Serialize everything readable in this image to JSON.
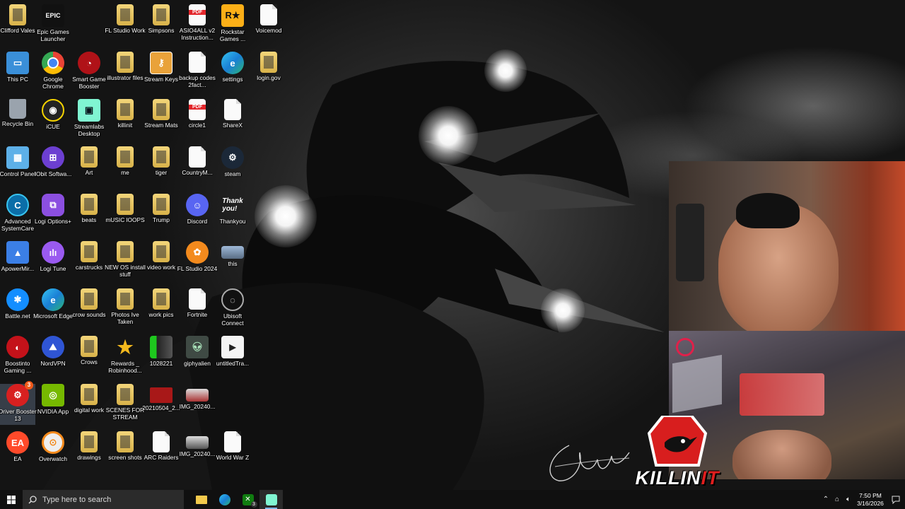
{
  "desktop": {
    "icons": [
      {
        "label": "Clifford Vales",
        "icon": "user-folder-icon"
      },
      {
        "label": "Epic Games Launcher",
        "icon": "epic-games-icon"
      },
      {
        "label": "FL Studio Work",
        "icon": "folder-icon"
      },
      {
        "label": "Simpsons",
        "icon": "folder-icon"
      },
      {
        "label": "ASIO4ALL v2 Instruction...",
        "icon": "pdf-icon"
      },
      {
        "label": "Rockstar Games ...",
        "icon": "rockstar-icon"
      },
      {
        "label": "Voicemod",
        "icon": "document-icon"
      },
      {
        "label": "This PC",
        "icon": "this-pc-icon"
      },
      {
        "label": "Google Chrome",
        "icon": "chrome-icon"
      },
      {
        "label": "Smart Game Booster",
        "icon": "game-booster-icon"
      },
      {
        "label": "illustrator files",
        "icon": "folder-icon"
      },
      {
        "label": "Stream Keys",
        "icon": "key-icon"
      },
      {
        "label": "backup codes 2fact...",
        "icon": "document-icon"
      },
      {
        "label": "settings",
        "icon": "edge-icon"
      },
      {
        "label": "login.gov",
        "icon": "folder-icon"
      },
      {
        "label": "Recycle Bin",
        "icon": "recycle-bin-icon"
      },
      {
        "label": "iCUE",
        "icon": "icue-icon"
      },
      {
        "label": "Streamlabs Desktop",
        "icon": "streamlabs-icon"
      },
      {
        "label": "killinit",
        "icon": "folder-icon"
      },
      {
        "label": "Stream Mats",
        "icon": "folder-icon"
      },
      {
        "label": "circle1",
        "icon": "pdf-icon"
      },
      {
        "label": "ShareX",
        "icon": "document-icon"
      },
      {
        "label": "Control Panel",
        "icon": "control-panel-icon"
      },
      {
        "label": "IObit Softwa...",
        "icon": "iobit-icon"
      },
      {
        "label": "Art",
        "icon": "folder-icon"
      },
      {
        "label": "me",
        "icon": "folder-icon"
      },
      {
        "label": "tiger",
        "icon": "folder-icon"
      },
      {
        "label": "CountryM...",
        "icon": "document-icon"
      },
      {
        "label": "steam",
        "icon": "steam-icon"
      },
      {
        "label": "Advanced SystemCare",
        "icon": "advanced-systemcare-icon"
      },
      {
        "label": "Logi Options+",
        "icon": "logi-options-icon"
      },
      {
        "label": "beats",
        "icon": "folder-icon"
      },
      {
        "label": "mUSIC lOOPS",
        "icon": "folder-icon"
      },
      {
        "label": "Trump",
        "icon": "folder-icon"
      },
      {
        "label": "Discord",
        "icon": "discord-icon"
      },
      {
        "label": "Thankyou",
        "icon": "thankyou-image-icon"
      },
      {
        "label": "ApowerMir...",
        "icon": "apowermirror-icon"
      },
      {
        "label": "Logi Tune",
        "icon": "logi-tune-icon"
      },
      {
        "label": "carstrucks",
        "icon": "folder-icon"
      },
      {
        "label": "NEW OS install stuff",
        "icon": "folder-icon"
      },
      {
        "label": "video work",
        "icon": "folder-icon"
      },
      {
        "label": "FL Studio 2024",
        "icon": "fl-studio-icon"
      },
      {
        "label": "this",
        "icon": "image-file-icon"
      },
      {
        "label": "Battle.net",
        "icon": "battlenet-icon"
      },
      {
        "label": "Microsoft Edge",
        "icon": "edge-icon"
      },
      {
        "label": "crow sounds",
        "icon": "folder-icon"
      },
      {
        "label": "Photos Ive Taken",
        "icon": "folder-icon"
      },
      {
        "label": "work pics",
        "icon": "folder-icon"
      },
      {
        "label": "Fortnite",
        "icon": "document-icon"
      },
      {
        "label": "Ubisoft Connect",
        "icon": "ubisoft-icon"
      },
      {
        "label": "Boostinto Gaming ...",
        "icon": "boost-icon"
      },
      {
        "label": "NordVPN",
        "icon": "nordvpn-icon"
      },
      {
        "label": "Crows",
        "icon": "folder-icon"
      },
      {
        "label": "Rewards _ Robinhood...",
        "icon": "star-icon"
      },
      {
        "label": "1028221",
        "icon": "image-file-icon"
      },
      {
        "label": "giphyalien",
        "icon": "alien-image-icon"
      },
      {
        "label": "untitledTra...",
        "icon": "video-file-icon"
      },
      {
        "label": "Driver Booster 13",
        "icon": "driver-booster-icon"
      },
      {
        "label": "NVIDIA App",
        "icon": "nvidia-icon"
      },
      {
        "label": "digital work",
        "icon": "folder-icon"
      },
      {
        "label": "SCENES FOR STREAM",
        "icon": "folder-icon"
      },
      {
        "label": "20210504_2...",
        "icon": "image-file-icon"
      },
      {
        "label": "IMG_20240...",
        "icon": "image-file-icon"
      },
      {
        "label": "EA",
        "icon": "ea-icon"
      },
      {
        "label": "Overwatch",
        "icon": "overwatch-icon"
      },
      {
        "label": "drawings",
        "icon": "folder-icon"
      },
      {
        "label": "screen shots",
        "icon": "folder-icon"
      },
      {
        "label": "ARC Raiders",
        "icon": "document-icon"
      },
      {
        "label": "IMG_20240...",
        "icon": "image-file-icon"
      },
      {
        "label": "World War Z",
        "icon": "document-icon"
      }
    ],
    "driver_booster_badge": "3"
  },
  "overlay": {
    "logo_text_main": "KILLIN",
    "logo_text_accent": "IT"
  },
  "taskbar": {
    "search_placeholder": "Type here to search",
    "apps": [
      {
        "name": "file-explorer-icon",
        "active": false
      },
      {
        "name": "edge-icon",
        "active": false
      },
      {
        "name": "xbox-icon",
        "active": false,
        "badge": "3"
      },
      {
        "name": "streamlabs-icon",
        "active": true
      }
    ],
    "time": "7:50 PM",
    "date": "3/16/2026"
  },
  "colors": {
    "taskbar_bg": "#101010",
    "search_bg": "#2b2b2b",
    "folder_yellow": "#e9c24b",
    "logo_red": "#e01e1e"
  }
}
